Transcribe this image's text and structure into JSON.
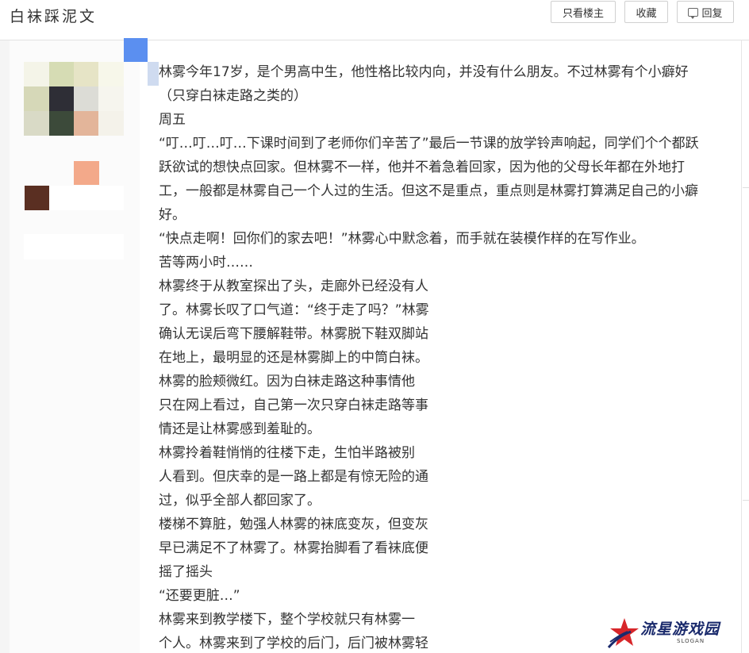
{
  "header": {
    "title": "白袜踩泥文",
    "buttons": {
      "only_owner": "只看楼主",
      "favorite": "收藏",
      "reply": "回复"
    }
  },
  "post": {
    "lines": [
      "林雾今年17岁，是个男高中生，他性格比较内向，并没有什么朋友。不过林雾有个小癖好",
      "（只穿白袜走路之类的）",
      "周五",
      "“叮…叮…叮…下课时间到了老师你们辛苦了”最后一节课的放学铃声响起，同学们个个都跃",
      "跃欲试的想快点回家。但林雾不一样，他并不着急着回家，因为他的父母长年都在外地打",
      "工，一般都是林雾自己一个人过的生活。但这不是重点，重点则是林雾打算满足自己的小癖",
      "好。",
      "“快点走啊！回你们的家去吧！”林雾心中默念着，而手就在装模作样的在写作业。",
      "苦等两小时……",
      "林雾终于从教室探出了头，走廊外已经没有人",
      "了。林雾长叹了口气道：“终于走了吗？”林雾",
      "确认无误后弯下腰解鞋带。林雾脱下鞋双脚站",
      "在地上，最明显的还是林雾脚上的中筒白袜。",
      "林雾的脸颊微红。因为白袜走路这种事情他",
      "只在网上看过，自己第一次只穿白袜走路等事",
      "情还是让林雾感到羞耻的。",
      "林雾拎着鞋悄悄的往楼下走，生怕半路被别",
      "人看到。但庆幸的是一路上都是有惊无险的通",
      "过，似乎全部人都回家了。",
      "楼梯不算脏，勉强人林雾的袜底变灰，但变灰",
      "早已满足不了林雾了。林雾抬脚看了看袜底便",
      "摇了摇头",
      "“还要更脏…”",
      "林雾来到教学楼下，整个学校就只有林雾一",
      "个人。林雾来到了学校的后门，后门被林雾轻"
    ]
  },
  "watermark": {
    "text": "流星游戏园",
    "sub": "SLOGAN"
  },
  "colors": {
    "accent_blue": "#5b8ff0",
    "watermark_navy": "#1a2a6c",
    "watermark_red": "#d7262a"
  }
}
